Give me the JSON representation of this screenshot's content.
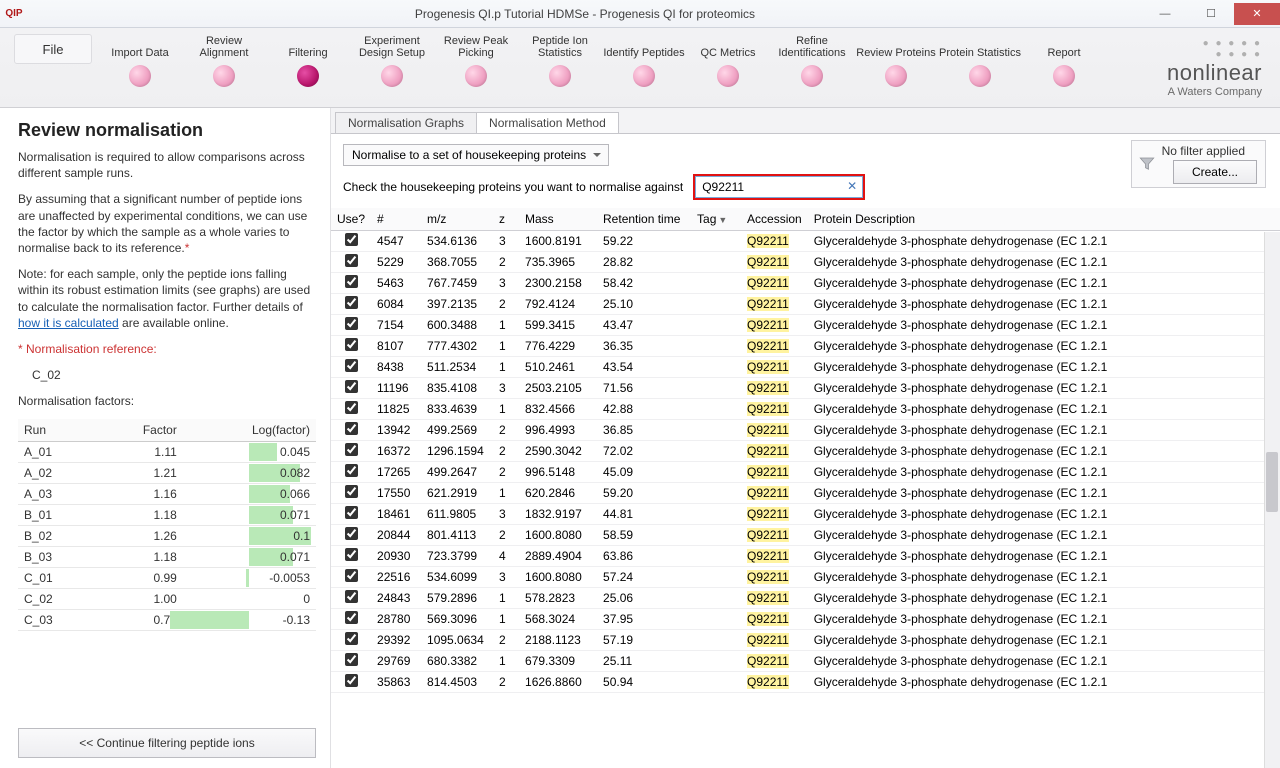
{
  "window": {
    "icon": "QIP",
    "title": "Progenesis QI.p Tutorial HDMSe - Progenesis QI for proteomics"
  },
  "workflow": {
    "file": "File",
    "steps": [
      {
        "label": "Import Data",
        "active": false
      },
      {
        "label": "Review Alignment",
        "active": false
      },
      {
        "label": "Filtering",
        "active": true
      },
      {
        "label": "Experiment Design Setup",
        "active": false
      },
      {
        "label": "Review Peak Picking",
        "active": false
      },
      {
        "label": "Peptide Ion Statistics",
        "active": false
      },
      {
        "label": "Identify Peptides",
        "active": false
      },
      {
        "label": "QC Metrics",
        "active": false
      },
      {
        "label": "Refine Identifications",
        "active": false
      },
      {
        "label": "Review Proteins",
        "active": false
      },
      {
        "label": "Protein Statistics",
        "active": false
      },
      {
        "label": "Report",
        "active": false
      }
    ]
  },
  "brand": {
    "name": "nonlinear",
    "sub": "A Waters Company"
  },
  "sidebar": {
    "heading": "Review normalisation",
    "p1": "Normalisation is required to allow comparisons across different sample runs.",
    "p2a": "By assuming that a significant number of peptide ions are unaffected by experimental conditions, we can use the factor by which the sample as a whole varies to normalise back to its reference.",
    "p2star": "*",
    "p3a": "Note: for each sample, only the peptide ions falling within its robust estimation limits (see graphs) are used to calculate the normalisation factor. Further details of ",
    "p3link": "how it is calculated",
    "p3b": " are available online.",
    "refLabel": "* Normalisation reference:",
    "refValue": "C_02",
    "nfLabel": "Normalisation factors:",
    "nfHeaders": {
      "run": "Run",
      "factor": "Factor",
      "log": "Log(factor)"
    },
    "nfRows": [
      {
        "run": "A_01",
        "factor": "1.11",
        "log": "0.045"
      },
      {
        "run": "A_02",
        "factor": "1.21",
        "log": "0.082"
      },
      {
        "run": "A_03",
        "factor": "1.16",
        "log": "0.066"
      },
      {
        "run": "B_01",
        "factor": "1.18",
        "log": "0.071"
      },
      {
        "run": "B_02",
        "factor": "1.26",
        "log": "0.1"
      },
      {
        "run": "B_03",
        "factor": "1.18",
        "log": "0.071"
      },
      {
        "run": "C_01",
        "factor": "0.99",
        "log": "-0.0053"
      },
      {
        "run": "C_02",
        "factor": "1.00",
        "log": "0"
      },
      {
        "run": "C_03",
        "factor": "0.74",
        "log": "-0.13"
      }
    ],
    "continue": "<<  Continue filtering peptide ions"
  },
  "tabs": {
    "graphs": "Normalisation Graphs",
    "method": "Normalisation Method"
  },
  "toolbar": {
    "selectLabel": "Normalise to a set of housekeeping proteins",
    "filterText": "No filter applied",
    "createBtn": "Create..."
  },
  "checkRow": {
    "prompt": "Check the housekeeping proteins you want to normalise against",
    "searchValue": "Q92211"
  },
  "table": {
    "headers": {
      "use": "Use?",
      "num": "#",
      "mz": "m/z",
      "z": "z",
      "mass": "Mass",
      "rt": "Retention time",
      "tag": "Tag",
      "acc": "Accession",
      "desc": "Protein Description"
    },
    "rows": [
      {
        "n": "4547",
        "mz": "534.6136",
        "z": "3",
        "mass": "1600.8191",
        "rt": "59.22"
      },
      {
        "n": "5229",
        "mz": "368.7055",
        "z": "2",
        "mass": "735.3965",
        "rt": "28.82"
      },
      {
        "n": "5463",
        "mz": "767.7459",
        "z": "3",
        "mass": "2300.2158",
        "rt": "58.42"
      },
      {
        "n": "6084",
        "mz": "397.2135",
        "z": "2",
        "mass": "792.4124",
        "rt": "25.10"
      },
      {
        "n": "7154",
        "mz": "600.3488",
        "z": "1",
        "mass": "599.3415",
        "rt": "43.47"
      },
      {
        "n": "8107",
        "mz": "777.4302",
        "z": "1",
        "mass": "776.4229",
        "rt": "36.35"
      },
      {
        "n": "8438",
        "mz": "511.2534",
        "z": "1",
        "mass": "510.2461",
        "rt": "43.54"
      },
      {
        "n": "11196",
        "mz": "835.4108",
        "z": "3",
        "mass": "2503.2105",
        "rt": "71.56"
      },
      {
        "n": "11825",
        "mz": "833.4639",
        "z": "1",
        "mass": "832.4566",
        "rt": "42.88"
      },
      {
        "n": "13942",
        "mz": "499.2569",
        "z": "2",
        "mass": "996.4993",
        "rt": "36.85"
      },
      {
        "n": "16372",
        "mz": "1296.1594",
        "z": "2",
        "mass": "2590.3042",
        "rt": "72.02"
      },
      {
        "n": "17265",
        "mz": "499.2647",
        "z": "2",
        "mass": "996.5148",
        "rt": "45.09"
      },
      {
        "n": "17550",
        "mz": "621.2919",
        "z": "1",
        "mass": "620.2846",
        "rt": "59.20"
      },
      {
        "n": "18461",
        "mz": "611.9805",
        "z": "3",
        "mass": "1832.9197",
        "rt": "44.81"
      },
      {
        "n": "20844",
        "mz": "801.4113",
        "z": "2",
        "mass": "1600.8080",
        "rt": "58.59"
      },
      {
        "n": "20930",
        "mz": "723.3799",
        "z": "4",
        "mass": "2889.4904",
        "rt": "63.86"
      },
      {
        "n": "22516",
        "mz": "534.6099",
        "z": "3",
        "mass": "1600.8080",
        "rt": "57.24"
      },
      {
        "n": "24843",
        "mz": "579.2896",
        "z": "1",
        "mass": "578.2823",
        "rt": "25.06"
      },
      {
        "n": "28780",
        "mz": "569.3096",
        "z": "1",
        "mass": "568.3024",
        "rt": "37.95"
      },
      {
        "n": "29392",
        "mz": "1095.0634",
        "z": "2",
        "mass": "2188.1123",
        "rt": "57.19"
      },
      {
        "n": "29769",
        "mz": "680.3382",
        "z": "1",
        "mass": "679.3309",
        "rt": "25.11"
      },
      {
        "n": "35863",
        "mz": "814.4503",
        "z": "2",
        "mass": "1626.8860",
        "rt": "50.94"
      }
    ],
    "accession": "Q92211",
    "description": "Glyceraldehyde 3-phosphate dehydrogenase (EC 1.2.1"
  }
}
